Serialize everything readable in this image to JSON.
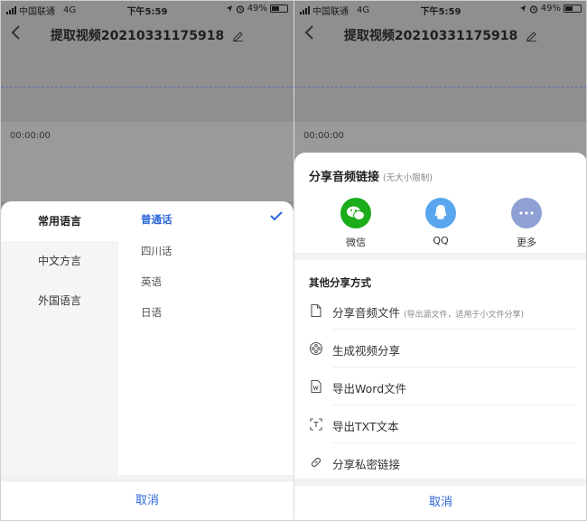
{
  "status_bar": {
    "carrier": "中国联通",
    "network": "4G",
    "time": "下午5:59",
    "battery": "49%"
  },
  "header": {
    "title": "提取视频20210331175918"
  },
  "player": {
    "timecode": "00:00:00"
  },
  "language_sheet": {
    "categories": [
      {
        "label": "常用语言",
        "active": true
      },
      {
        "label": "中文方言",
        "active": false
      },
      {
        "label": "外国语言",
        "active": false
      }
    ],
    "options": [
      {
        "label": "普通话",
        "selected": true
      },
      {
        "label": "四川话",
        "selected": false
      },
      {
        "label": "英语",
        "selected": false
      },
      {
        "label": "日语",
        "selected": false
      }
    ],
    "cancel": "取消"
  },
  "share_sheet": {
    "title": "分享音频链接",
    "title_note": "(无大小限制)",
    "apps": [
      {
        "label": "微信",
        "icon": "wechat-icon",
        "color": "#1aad19"
      },
      {
        "label": "QQ",
        "icon": "qq-icon",
        "color": "#5aa6ee"
      },
      {
        "label": "更多",
        "icon": "more-icon",
        "color": "#8fa0d4"
      }
    ],
    "other_title": "其他分享方式",
    "options": [
      {
        "label": "分享音频文件",
        "note": "(导出源文件，适用于小文件分享)",
        "icon": "file-icon"
      },
      {
        "label": "生成视频分享",
        "note": "",
        "icon": "film-reel-icon"
      },
      {
        "label": "导出Word文件",
        "note": "",
        "icon": "word-doc-icon"
      },
      {
        "label": "导出TXT文本",
        "note": "",
        "icon": "txt-text-icon"
      },
      {
        "label": "分享私密链接",
        "note": "",
        "icon": "link-icon"
      }
    ],
    "cancel": "取消"
  },
  "colors": {
    "accent": "#2b66d9",
    "overlay": "#8f8f8f"
  }
}
